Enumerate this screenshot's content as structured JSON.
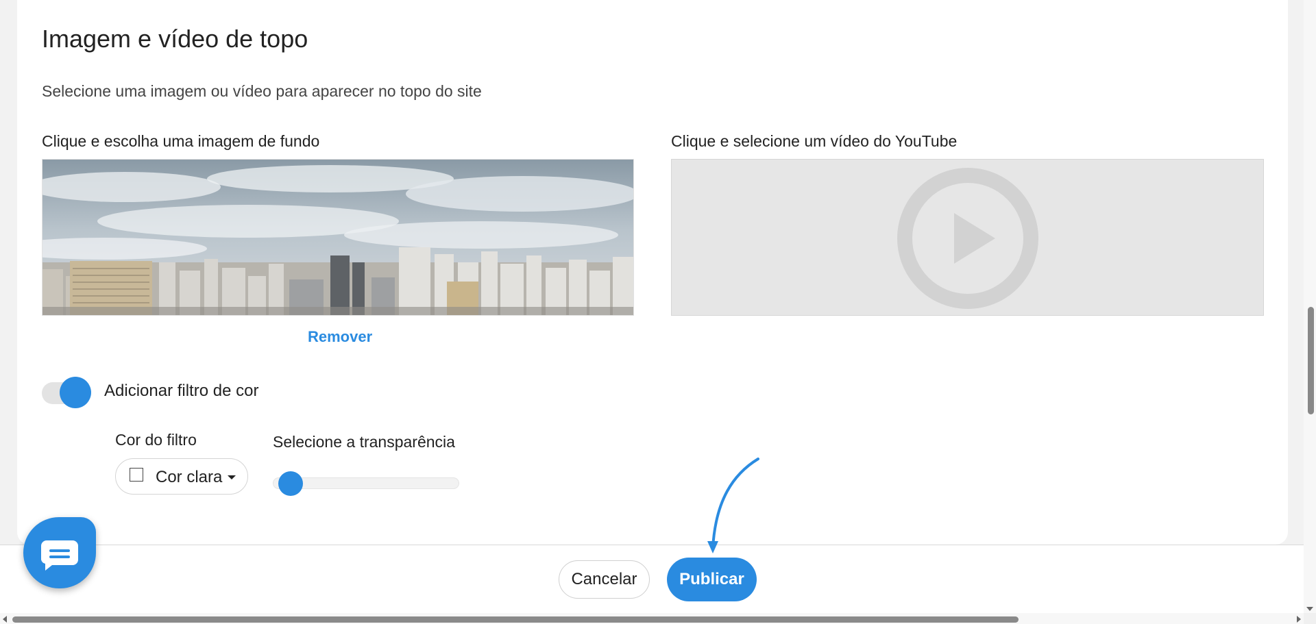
{
  "section": {
    "title": "Imagem e vídeo de topo",
    "subtitle": "Selecione uma imagem ou vídeo para aparecer no topo do site"
  },
  "image_picker": {
    "label": "Clique e escolha uma imagem de fundo",
    "remove_label": "Remover"
  },
  "video_picker": {
    "label": "Clique e selecione um vídeo do YouTube",
    "icon": "play-icon"
  },
  "color_filter": {
    "toggle_label": "Adicionar filtro de cor",
    "enabled": true,
    "color_label": "Cor do filtro",
    "color_value": "Cor clara",
    "transparency_label": "Selecione a transparência",
    "transparency_value": 0
  },
  "footer": {
    "cancel_label": "Cancelar",
    "publish_label": "Publicar"
  },
  "colors": {
    "accent": "#2a8be0",
    "placeholder": "#e6e6e6"
  },
  "icons": {
    "chat": "chat-icon",
    "arrow": "pointer-arrow"
  }
}
